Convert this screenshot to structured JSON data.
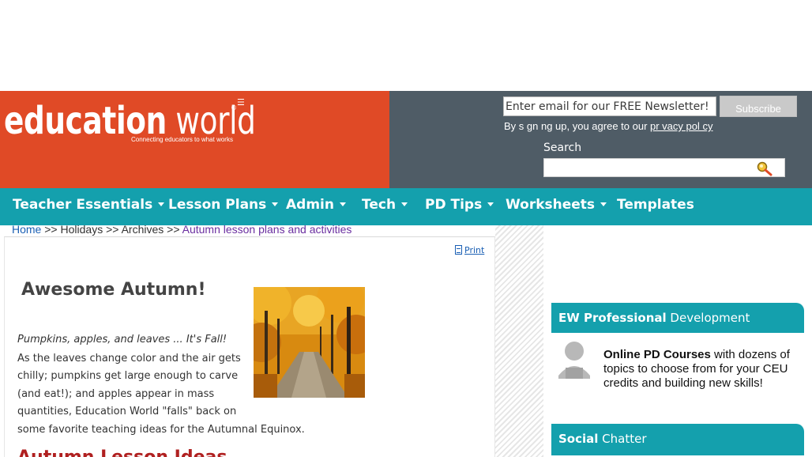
{
  "header": {
    "logo_word_bold": "education",
    "logo_word_light": "world",
    "logo_registered": "®",
    "logo_tagline": "Connecting educators to what works",
    "newsletter_placeholder": "Enter email for our FREE Newsletter!",
    "subscribe_label": "Subscribe",
    "signup_note_prefix": "By s gn ng up, you agree to our ",
    "privacy_link": "pr vacy pol cy",
    "search_label": "Search",
    "colors": {
      "logo_bg": "#e04a26",
      "header_bg": "#4f5c66",
      "nav_bg": "#14a0ad"
    }
  },
  "nav": {
    "items": [
      {
        "label": "Teacher Essentials",
        "has_dropdown": true
      },
      {
        "label": "Lesson Plans",
        "has_dropdown": true
      },
      {
        "label": "Admin",
        "has_dropdown": true
      },
      {
        "label": "Tech",
        "has_dropdown": true
      },
      {
        "label": "PD Tips",
        "has_dropdown": true
      },
      {
        "label": "Worksheets",
        "has_dropdown": true
      },
      {
        "label": "Templates",
        "has_dropdown": false
      }
    ]
  },
  "breadcrumb": {
    "home": "Home",
    "sep1": " >> ",
    "holidays": "Holidays",
    "sep2": " >> ",
    "archives": "Archives",
    "sep3": " >> ",
    "current": "Autumn lesson plans and activities"
  },
  "article": {
    "print_label": "Print",
    "title": "Awesome Autumn!",
    "intro": "Pumpkins, apples, and leaves ... It's Fall!",
    "body_lines": [
      "As the leaves change color and the air gets",
      "chilly; pumpkins get large enough to carve",
      "(and eat!); and apples appear in mass",
      "quantities, Education World \"falls\" back on",
      "some favorite teaching ideas for the Autumnal Equinox."
    ],
    "subheading": "Autumn Lesson Ideas"
  },
  "sidebar": {
    "pd_header_bold": "EW Professional",
    "pd_header_light": " Development",
    "pd_text_bold": "Online PD Courses",
    "pd_text_rest": " with dozens of topics to choose from for your CEU credits and building new skills!",
    "social_header_bold": "Social",
    "social_header_light": " Chatter"
  }
}
